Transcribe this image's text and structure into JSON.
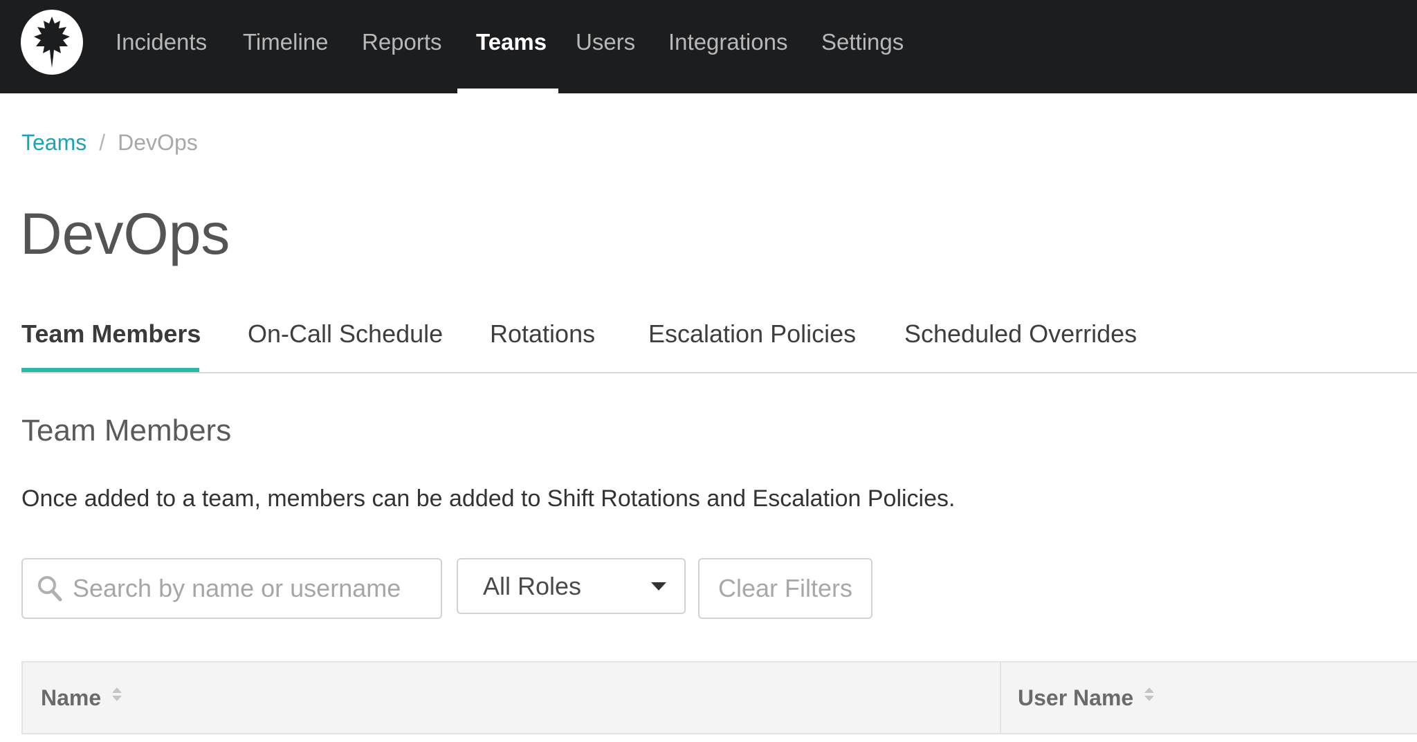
{
  "nav": {
    "items": [
      {
        "label": "Incidents",
        "active": false
      },
      {
        "label": "Timeline",
        "active": false
      },
      {
        "label": "Reports",
        "active": false
      },
      {
        "label": "Teams",
        "active": true
      },
      {
        "label": "Users",
        "active": false
      },
      {
        "label": "Integrations",
        "active": false
      },
      {
        "label": "Settings",
        "active": false
      }
    ]
  },
  "breadcrumb": {
    "parent": "Teams",
    "separator": "/",
    "current": "DevOps"
  },
  "page": {
    "title": "DevOps"
  },
  "tabs": [
    {
      "label": "Team Members",
      "active": true
    },
    {
      "label": "On-Call Schedule",
      "active": false
    },
    {
      "label": "Rotations",
      "active": false
    },
    {
      "label": "Escalation Policies",
      "active": false
    },
    {
      "label": "Scheduled Overrides",
      "active": false
    }
  ],
  "section": {
    "title": "Team Members",
    "description": "Once added to a team, members can be added to Shift Rotations and Escalation Policies."
  },
  "filters": {
    "search_placeholder": "Search by name or username",
    "search_value": "",
    "roles_selected": "All Roles",
    "clear_label": "Clear Filters"
  },
  "table": {
    "columns": [
      "Name",
      "User Name"
    ]
  },
  "colors": {
    "nav_background": "#1c1d1f",
    "link_accent": "#1ba4b5",
    "tab_underline": "#2bb8a5"
  }
}
